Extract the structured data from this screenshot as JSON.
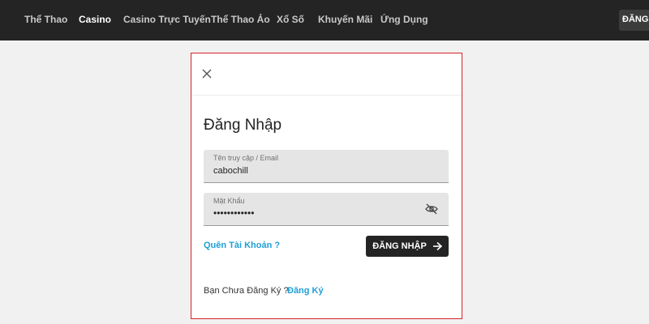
{
  "nav": {
    "items": [
      {
        "label": "Thể Thao"
      },
      {
        "label": "Casino",
        "active": true
      },
      {
        "label": "Casino Trực Tuyến"
      },
      {
        "label": "Thể Thao Ảo"
      },
      {
        "label": "Xổ Số"
      },
      {
        "label": "Khuyến Mãi"
      },
      {
        "label": "Ứng Dụng"
      }
    ],
    "register_label": "ĐĂNG KÝ"
  },
  "modal": {
    "close_icon": "close-icon",
    "title": "Đăng Nhập",
    "username": {
      "label": "Tên truy cập / Email",
      "value": "cabochill"
    },
    "password": {
      "label": "Mật Khẩu",
      "masked_value": "••••••••••••",
      "toggle_icon": "eye-slash-icon"
    },
    "forgot_label": "Quên Tài Khoản ?",
    "login_label": "ĐĂNG NHẬP",
    "login_icon": "arrow-right-icon",
    "no_account_text": "Bạn Chưa Đăng Ký ?",
    "register_link_label": "Đăng Ký"
  },
  "colors": {
    "topbar": "#242424",
    "link": "#1d9fd8",
    "modal_border": "#d8232a",
    "page_bg": "#f1f1f1"
  }
}
